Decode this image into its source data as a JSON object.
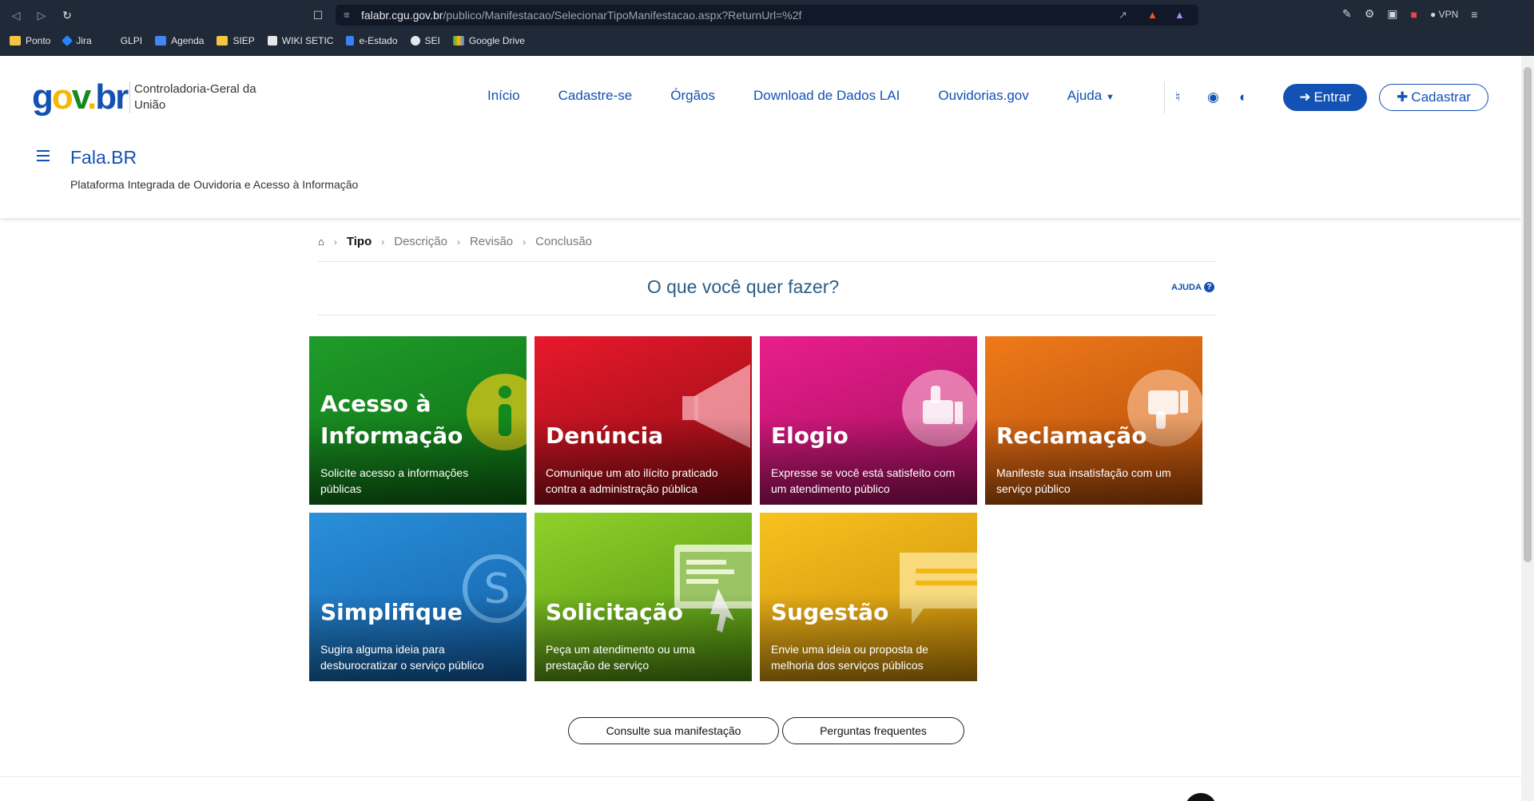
{
  "browser": {
    "url_host": "falabr.cgu.gov.br",
    "url_path": "/publico/Manifestacao/SelecionarTipoManifestacao.aspx?ReturnUrl=%2f",
    "vpn_label": "VPN",
    "bookmarks": [
      {
        "label": "Ponto",
        "color": "#f5c542"
      },
      {
        "label": "Jira",
        "color": "#2684ff"
      },
      {
        "label": "GLPI",
        "color": "#1f2937"
      },
      {
        "label": "Agenda",
        "color": "#4285f4"
      },
      {
        "label": "SIEP",
        "color": "#f5c542"
      },
      {
        "label": "WIKI SETIC",
        "color": "#e5e7eb"
      },
      {
        "label": "e-Estado",
        "color": "#3b82f6"
      },
      {
        "label": "SEI",
        "color": "#e5e7eb"
      },
      {
        "label": "Google Drive",
        "color": "#34a853"
      }
    ]
  },
  "header": {
    "org_name": "Controladoria-Geral da União",
    "nav": [
      "Início",
      "Cadastre-se",
      "Órgãos",
      "Download de Dados LAI",
      "Ouvidorias.gov",
      "Ajuda"
    ],
    "enter_label": "Entrar",
    "register_label": "Cadastrar",
    "system_title": "Fala.BR",
    "system_subtitle": "Plataforma Integrada de Ouvidoria e Acesso à Informação"
  },
  "breadcrumb": [
    "Tipo",
    "Descrição",
    "Revisão",
    "Conclusão"
  ],
  "question": "O que você quer fazer?",
  "help_label": "AJUDA",
  "tiles": [
    {
      "title_1": "Acesso à",
      "title_2": "Informação",
      "desc": "Solicite acesso a informações públicas",
      "color_top": "#1f9c2a",
      "color_bottom": "#0d6b12"
    },
    {
      "title_1": "Denúncia",
      "desc": "Comunique um ato ilícito praticado contra a administração pública",
      "color_top": "#e8192c",
      "color_bottom": "#8a0b12"
    },
    {
      "title_1": "Elogio",
      "desc": "Expresse se você está satisfeito com um atendimento público",
      "color_top": "#e91e8c",
      "color_bottom": "#a00e5c"
    },
    {
      "title_1": "Reclamação",
      "desc": "Manifeste sua insatisfação com um serviço público",
      "color_top": "#f07a1a",
      "color_bottom": "#b04a08"
    },
    {
      "title_1": "Simplifique",
      "desc": "Sugira alguma ideia para desburocratizar o serviço público",
      "color_top": "#2a8fd9",
      "color_bottom": "#125fa8"
    },
    {
      "title_1": "Solicitação",
      "desc": "Peça um atendimento ou uma prestação de serviço",
      "color_top": "#8fd12a",
      "color_bottom": "#4f8f10"
    },
    {
      "title_1": "Sugestão",
      "desc": "Envie uma ideia ou proposta de melhoria dos serviços públicos",
      "color_top": "#f7c21f",
      "color_bottom": "#c98a08"
    }
  ],
  "buttons": {
    "consult": "Consulte sua manifestação",
    "faq": "Perguntas frequentes"
  }
}
